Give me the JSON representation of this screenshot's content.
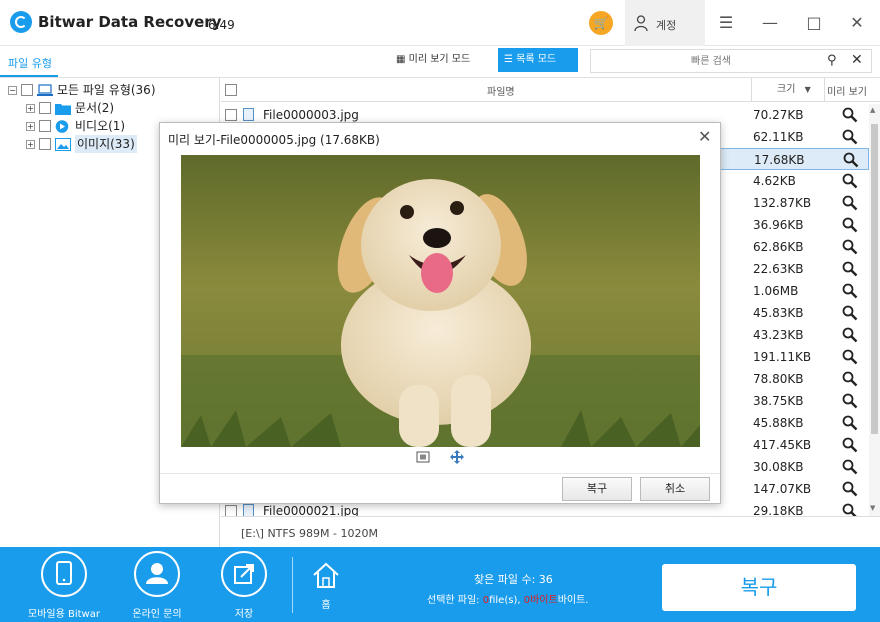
{
  "app": {
    "title": "Bitwar Data Recovery",
    "version": "6.49",
    "account_label": "계정"
  },
  "toolbar": {
    "file_type_tab": "파일 유형",
    "preview_mode": "미리 보기 모드",
    "list_mode": "목록 모드",
    "search_placeholder": "빠른 검색"
  },
  "tree": {
    "root": "모든 파일 유형(36)",
    "children": [
      {
        "label": "문서(2)",
        "icon": "folder-icon"
      },
      {
        "label": "비디오(1)",
        "icon": "video-icon"
      },
      {
        "label": "이미지(33)",
        "icon": "image-icon"
      }
    ]
  },
  "table": {
    "col_name": "파일명",
    "col_size": "크기",
    "col_preview": "미리 보기",
    "rows": [
      {
        "name": "File0000003.jpg",
        "size": "70.27KB"
      },
      {
        "name": "",
        "size": "62.11KB"
      },
      {
        "name": "",
        "size": "17.68KB",
        "selected": true
      },
      {
        "name": "",
        "size": "4.62KB"
      },
      {
        "name": "",
        "size": "132.87KB"
      },
      {
        "name": "",
        "size": "36.96KB"
      },
      {
        "name": "",
        "size": "62.86KB"
      },
      {
        "name": "",
        "size": "22.63KB"
      },
      {
        "name": "",
        "size": "1.06MB"
      },
      {
        "name": "",
        "size": "45.83KB"
      },
      {
        "name": "",
        "size": "43.23KB"
      },
      {
        "name": "",
        "size": "191.11KB"
      },
      {
        "name": "",
        "size": "78.80KB"
      },
      {
        "name": "",
        "size": "38.75KB"
      },
      {
        "name": "",
        "size": "45.88KB"
      },
      {
        "name": "",
        "size": "417.45KB"
      },
      {
        "name": "",
        "size": "30.08KB"
      },
      {
        "name": "",
        "size": "147.07KB"
      },
      {
        "name": "File0000021.jpg",
        "size": "29.18KB"
      }
    ],
    "status": "[E:\\] NTFS 989M - 1020M"
  },
  "dialog": {
    "title": "미리 보기-File0000005.jpg (17.68KB)",
    "recover_button": "복구",
    "cancel_button": "취소"
  },
  "bottom": {
    "mobile_label": "모바일용 Bitwar",
    "online_label": "온라인 문의",
    "save_label": "저장",
    "home_label": "홈",
    "found_text": "찾은 파일 수: 36",
    "selected_prefix": "선택한 파일: ",
    "selected_count": "0",
    "selected_mid": "file(s), ",
    "selected_bytes": "0바이트",
    "selected_suffix": "바이트.",
    "recover_button": "복구"
  },
  "colors": {
    "accent": "#1a9cec",
    "cart": "#f5a623",
    "selection": "#dcebf7"
  }
}
